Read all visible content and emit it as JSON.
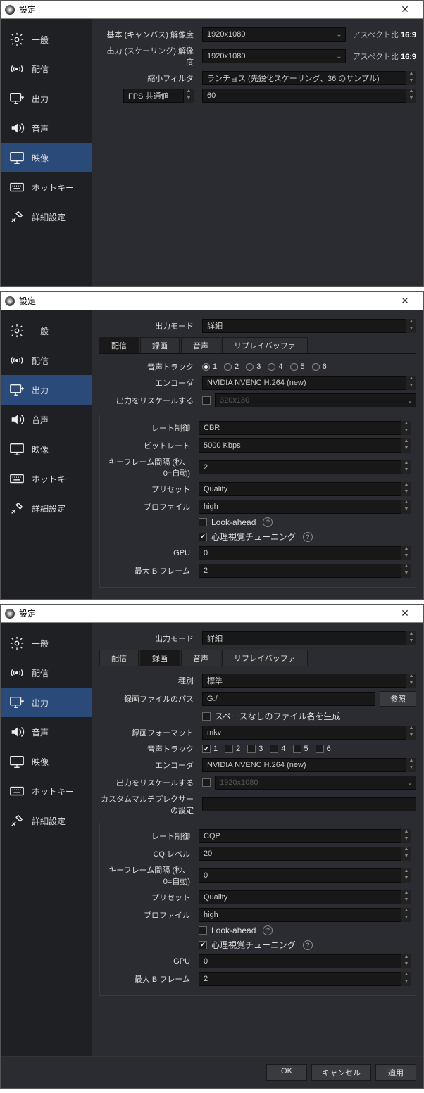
{
  "title": "設定",
  "aspect_prefix": "アスペクト比",
  "aspect_ratio": "16:9",
  "sidebar": {
    "general": "一般",
    "stream": "配信",
    "output": "出力",
    "audio": "音声",
    "video": "映像",
    "hotkey": "ホットキー",
    "advanced": "詳細設定"
  },
  "video": {
    "base_label": "基本 (キャンバス) 解像度",
    "base_value": "1920x1080",
    "out_label": "出力 (スケーリング) 解像度",
    "out_value": "1920x1080",
    "filter_label": "縮小フィルタ",
    "filter_value": "ランチョス (先鋭化スケーリング、36 のサンプル)",
    "fps_label": "FPS 共通値",
    "fps_value": "60"
  },
  "output": {
    "mode_label": "出力モード",
    "mode_value": "詳細",
    "tabs": {
      "stream": "配信",
      "record": "録画",
      "audio": "音声",
      "replay": "リプレイバッファ"
    },
    "track_label": "音声トラック",
    "encoder_label": "エンコーダ",
    "encoder_value": "NVIDIA NVENC H.264 (new)",
    "rescale_label": "出力をリスケールする",
    "rescale_value": "320x180",
    "rate_label": "レート制御",
    "bitrate_label": "ビットレート",
    "bitrate_value": "5000 Kbps",
    "keyframe_label": "キーフレーム間隔 (秒、0=自動)",
    "preset_label": "プリセット",
    "preset_value": "Quality",
    "profile_label": "プロファイル",
    "profile_value": "high",
    "lookahead": "Look-ahead",
    "psycho": "心理視覚チューニング",
    "gpu_label": "GPU",
    "gpu_value": "0",
    "bframe_label": "最大 B フレーム",
    "bframe_value": "2",
    "stream": {
      "tracks_on": 1,
      "rate_value": "CBR",
      "key_value": "2"
    },
    "record": {
      "type_label": "種別",
      "type_value": "標準",
      "path_label": "録画ファイルのパス",
      "path_value": "G:/",
      "browse": "参照",
      "nospace": "スペースなしのファイル名を生成",
      "format_label": "録画フォーマット",
      "format_value": "mkv",
      "tracks_on": 1,
      "rescale_value": "1920x1080",
      "muxer_label": "カスタムマルチプレクサーの設定",
      "rate_value": "CQP",
      "cq_label": "CQ レベル",
      "cq_value": "20",
      "key_value": "0"
    }
  },
  "buttons": {
    "ok": "OK",
    "cancel": "キャンセル",
    "apply": "適用"
  }
}
